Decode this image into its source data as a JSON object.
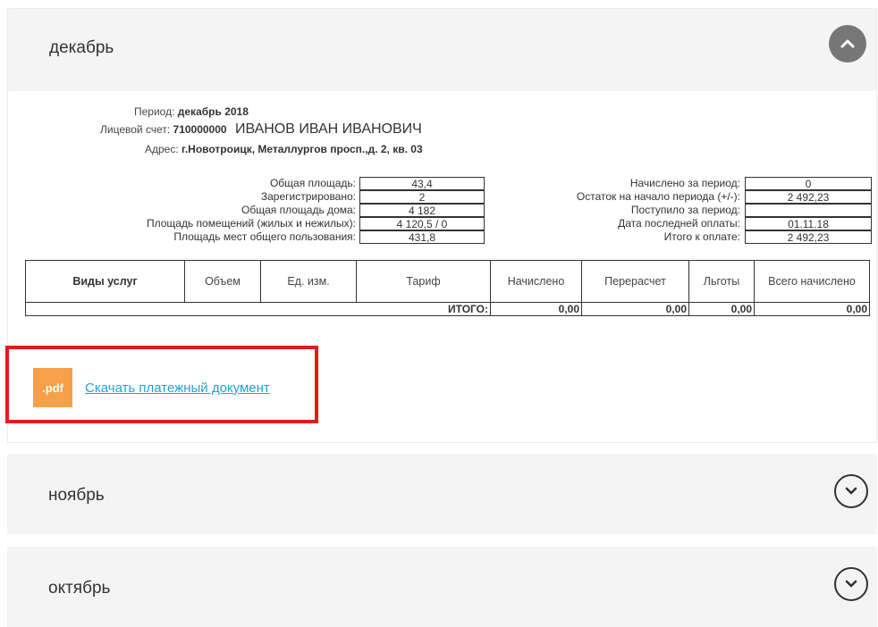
{
  "sections": {
    "december": {
      "title": "декабрь"
    },
    "november": {
      "title": "ноябрь"
    },
    "october": {
      "title": "октябрь"
    }
  },
  "account": {
    "period_label": "Период:",
    "period_value": "декабрь 2018",
    "account_label": "Лицевой счет:",
    "account_value": "710000000",
    "owner_name": "ИВАНОВ ИВАН ИВАНОВИЧ",
    "address_label": "Адрес:",
    "address_value": "г.Новотроицк, Металлургов просп.,д. 2, кв. 03"
  },
  "info_left": [
    {
      "label": "Общая площадь:",
      "value": "43,4"
    },
    {
      "label": "Зарегистрировано:",
      "value": "2"
    },
    {
      "label": "Общая площадь дома:",
      "value": "4 182"
    },
    {
      "label": "Площадь помещений (жилых и нежилых):",
      "value": "4 120,5 / 0"
    },
    {
      "label": "Площадь мест общего пользования:",
      "value": "431,8"
    }
  ],
  "info_right": [
    {
      "label": "Начислено за период:",
      "value": "0"
    },
    {
      "label": "Остаток на начало периода (+/-):",
      "value": "2 492,23"
    },
    {
      "label": "Поступило за период:",
      "value": ""
    },
    {
      "label": "Дата последней оплаты:",
      "value": "01.11.18"
    },
    {
      "label": "Итого к оплате:",
      "value": "2 492,23"
    }
  ],
  "table": {
    "headers": [
      "Виды услуг",
      "Объем",
      "Ед. изм.",
      "Тариф",
      "Начислено",
      "Перерасчет",
      "Льготы",
      "Всего начислено"
    ],
    "total_label": "ИТОГО:",
    "totals": [
      "0,00",
      "0,00",
      "0,00",
      "0,00"
    ]
  },
  "download": {
    "icon_text": ".pdf",
    "link_text": "Скачать платежный документ"
  },
  "icons": {
    "collapse": "chevron-up-icon",
    "expand": "chevron-down-icon"
  },
  "colors": {
    "pdf_icon_bg": "#f7a04b",
    "link": "#1ea2d7",
    "highlight_border": "#e21b1b",
    "header_bg": "#f4f4f4"
  }
}
